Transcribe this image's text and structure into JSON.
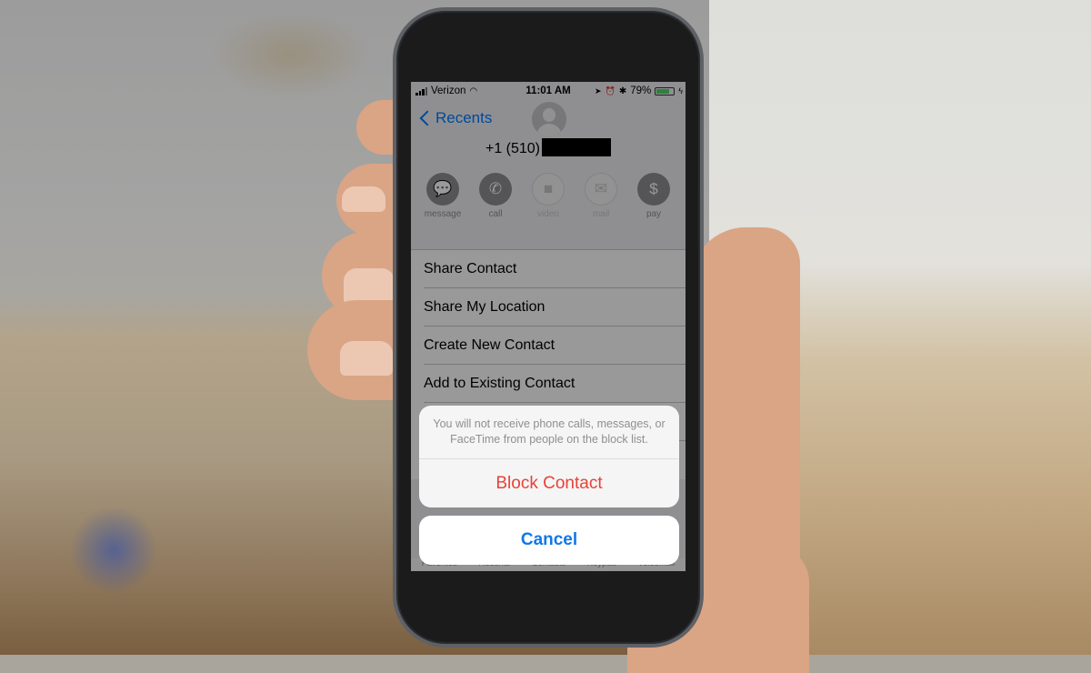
{
  "status_bar": {
    "carrier": "Verizon",
    "time": "11:01 AM",
    "battery_percent": "79%",
    "battery_level": 0.79,
    "icons": [
      "signal-icon",
      "wifi-icon",
      "location-icon",
      "alarm-icon",
      "bluetooth-icon",
      "battery-icon",
      "charging-icon"
    ]
  },
  "nav": {
    "back_label": "Recents"
  },
  "contact": {
    "phone_prefix": "+1 (510)",
    "phone_redacted": true
  },
  "actions": [
    {
      "label": "message",
      "icon": "message-icon",
      "glyph": "💬",
      "enabled": true
    },
    {
      "label": "call",
      "icon": "phone-icon",
      "glyph": "✆",
      "enabled": true
    },
    {
      "label": "video",
      "icon": "video-icon",
      "glyph": "■",
      "enabled": false
    },
    {
      "label": "mail",
      "icon": "mail-icon",
      "glyph": "✉",
      "enabled": false
    },
    {
      "label": "pay",
      "icon": "dollar-icon",
      "glyph": "$",
      "enabled": true
    }
  ],
  "list": {
    "items": [
      "Share Contact",
      "Share My Location",
      "Create New Contact",
      "Add to Existing Contact",
      "",
      ""
    ]
  },
  "tab_bar": {
    "items": [
      "Favorites",
      "Recents",
      "Contacts",
      "Keypad",
      "Voicemail"
    ]
  },
  "action_sheet": {
    "message": "You will not receive phone calls, messages, or FaceTime from people on the block list.",
    "destructive_label": "Block Contact",
    "cancel_label": "Cancel"
  },
  "colors": {
    "ios_blue": "#007aff",
    "ios_red": "#ff3b30",
    "battery_green": "#4cd964"
  }
}
